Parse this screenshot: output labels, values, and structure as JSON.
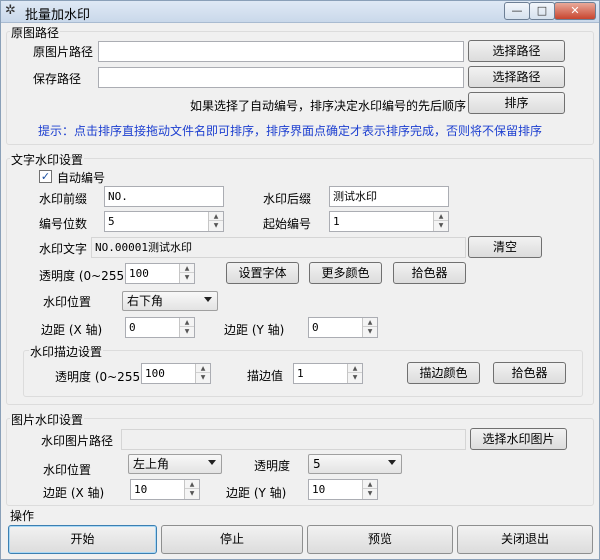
{
  "window": {
    "title": "批量加水印",
    "icon": "gear-icon",
    "min": "—",
    "max": "□",
    "close": "✕"
  },
  "source": {
    "group_label": "原图路径",
    "src_label": "原图片路径",
    "src_value": "",
    "src_btn": "选择路径",
    "save_label": "保存路径",
    "save_value": "",
    "save_btn": "选择路径",
    "order_note": "如果选择了自动编号，排序决定水印编号的先后顺序",
    "sort_btn": "排序",
    "tip": "提示：点击排序直接拖动文件名即可排序，排序界面点确定才表示排序完成，否则将不保留排序"
  },
  "text": {
    "group_label": "文字水印设置",
    "auto_number_label": "自动编号",
    "auto_number_checked": true,
    "prefix_label": "水印前缀",
    "prefix_value": "NO.",
    "suffix_label": "水印后缀",
    "suffix_value": "测试水印",
    "digits_label": "编号位数",
    "digits_value": "5",
    "start_label": "起始编号",
    "start_value": "1",
    "text_label": "水印文字",
    "text_value": "NO.00001测试水印",
    "clear_btn": "清空",
    "opacity_label": "透明度 (0~255)",
    "opacity_value": "100",
    "font_btn": "设置字体",
    "more_color_btn": "更多颜色",
    "picker_btn": "拾色器",
    "position_label": "水印位置",
    "position_value": "右下角",
    "margin_x_label": "边距 (X 轴)",
    "margin_x_value": "0",
    "margin_y_label": "边距 (Y 轴)",
    "margin_y_value": "0",
    "stroke": {
      "group_label": "水印描边设置",
      "opacity_label": "透明度 (0~255)",
      "opacity_value": "100",
      "stroke_label": "描边值",
      "stroke_value": "1",
      "color_btn": "描边颜色",
      "picker_btn": "拾色器"
    }
  },
  "image": {
    "group_label": "图片水印设置",
    "path_label": "水印图片路径",
    "path_value": "",
    "choose_btn": "选择水印图片",
    "position_label": "水印位置",
    "position_value": "左上角",
    "opacity_label": "透明度",
    "opacity_value": "5",
    "margin_x_label": "边距 (X 轴)",
    "margin_x_value": "10",
    "margin_y_label": "边距 (Y 轴)",
    "margin_y_value": "10"
  },
  "ops": {
    "group_label": "操作",
    "start_btn": "开始",
    "stop_btn": "停止",
    "preview_btn": "预览",
    "close_btn": "关闭退出"
  }
}
